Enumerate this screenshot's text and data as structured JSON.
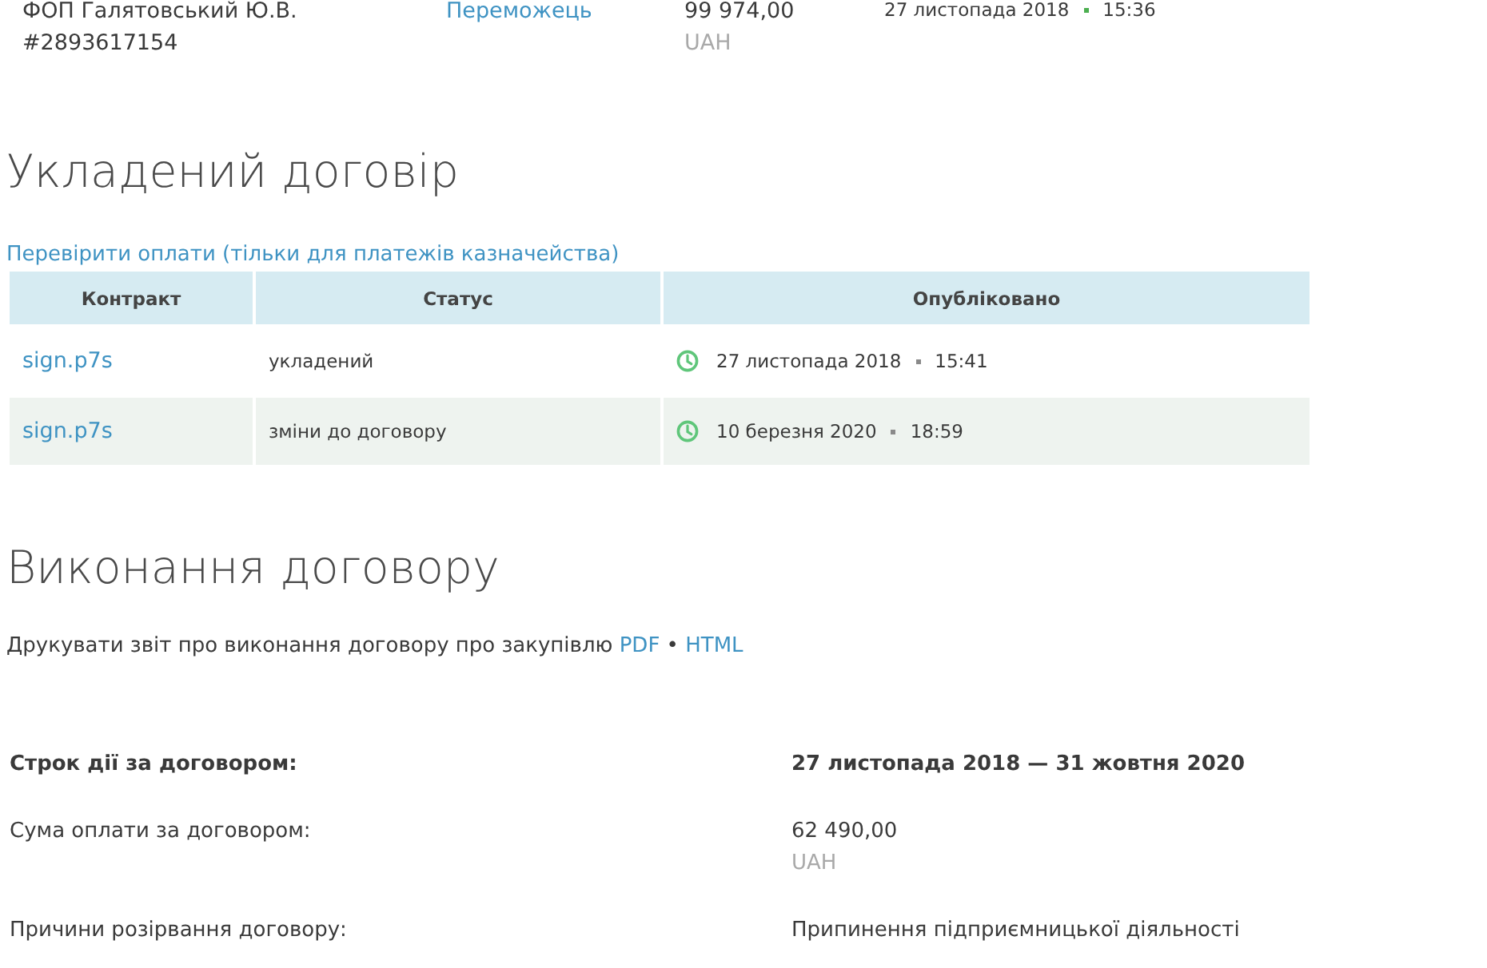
{
  "previous_row": {
    "supplier": "ФОП Галятовський Ю.В.",
    "supplier_id": "#2893617154",
    "status": "Переможець",
    "amount": "99 974,00",
    "currency": "UAH",
    "date": "27 листопада 2018",
    "time": "15:36"
  },
  "contract_section": {
    "title": "Укладений договір",
    "check_link": "Перевірити оплати (тільки для платежів казначейства)",
    "table": {
      "columns": [
        "Контракт",
        "Статус",
        "Опубліковано"
      ],
      "rows": [
        {
          "file": "sign.p7s",
          "status": "укладений",
          "date": "27 листопада 2018",
          "time": "15:41"
        },
        {
          "file": "sign.p7s",
          "status": "зміни до договору",
          "date": "10 березня 2020",
          "time": "18:59"
        }
      ]
    }
  },
  "execution_section": {
    "title": "Виконання договору",
    "report": {
      "text": "Друкувати звіт про виконання договору про закупівлю",
      "links": [
        "PDF",
        "HTML"
      ],
      "separator": "•"
    },
    "details": [
      {
        "label": "Строк дії за договором:",
        "value": "27 листопада 2018 — 31 жовтня 2020",
        "emphasized": true
      },
      {
        "label": "Сума оплати за договором:",
        "value": "62 490,00",
        "currency": "UAH",
        "emphasized": false
      },
      {
        "label": "Причини розірвання договору:",
        "value": "Припинення підприємницької діяльності",
        "emphasized": false
      }
    ]
  }
}
